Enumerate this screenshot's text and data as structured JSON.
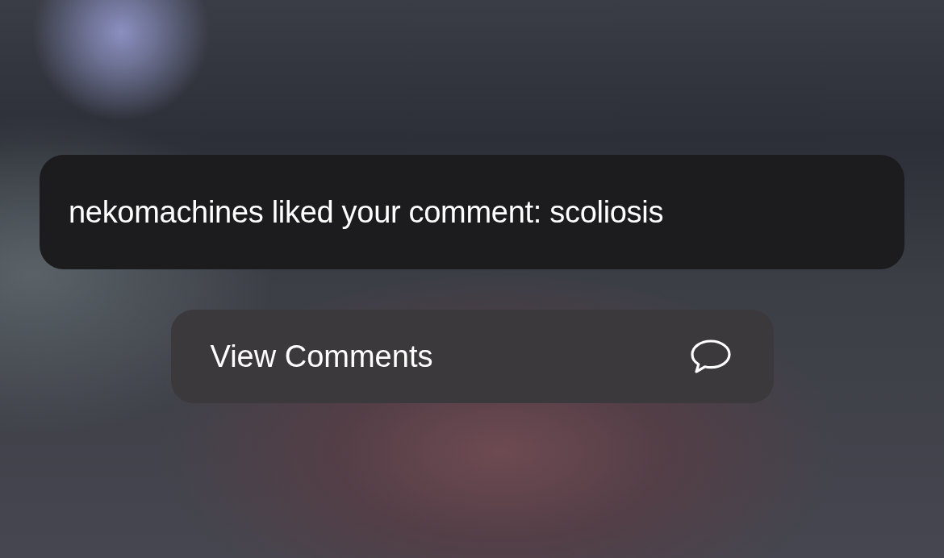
{
  "notification": {
    "text": "nekomachines liked your comment: scoliosis"
  },
  "actions": [
    {
      "label": "View Comments",
      "kind": "comment"
    }
  ]
}
